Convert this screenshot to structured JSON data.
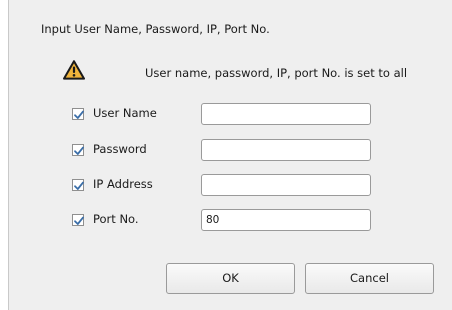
{
  "dialog": {
    "title": "Input User Name, Password, IP, Port No.",
    "warning": {
      "icon": "warning-icon",
      "text": "User name, password, IP, port No. is set to all"
    },
    "fields": [
      {
        "label": "User Name",
        "checked": true,
        "value": ""
      },
      {
        "label": "Password",
        "checked": true,
        "value": ""
      },
      {
        "label": "IP Address",
        "checked": true,
        "value": ""
      },
      {
        "label": "Port No.",
        "checked": true,
        "value": "80"
      }
    ],
    "buttons": {
      "ok": "OK",
      "cancel": "Cancel"
    }
  },
  "colors": {
    "dialog_background": "#efefef",
    "checkmark": "#3b6ea8",
    "warning_fill": "#f0b43c"
  }
}
